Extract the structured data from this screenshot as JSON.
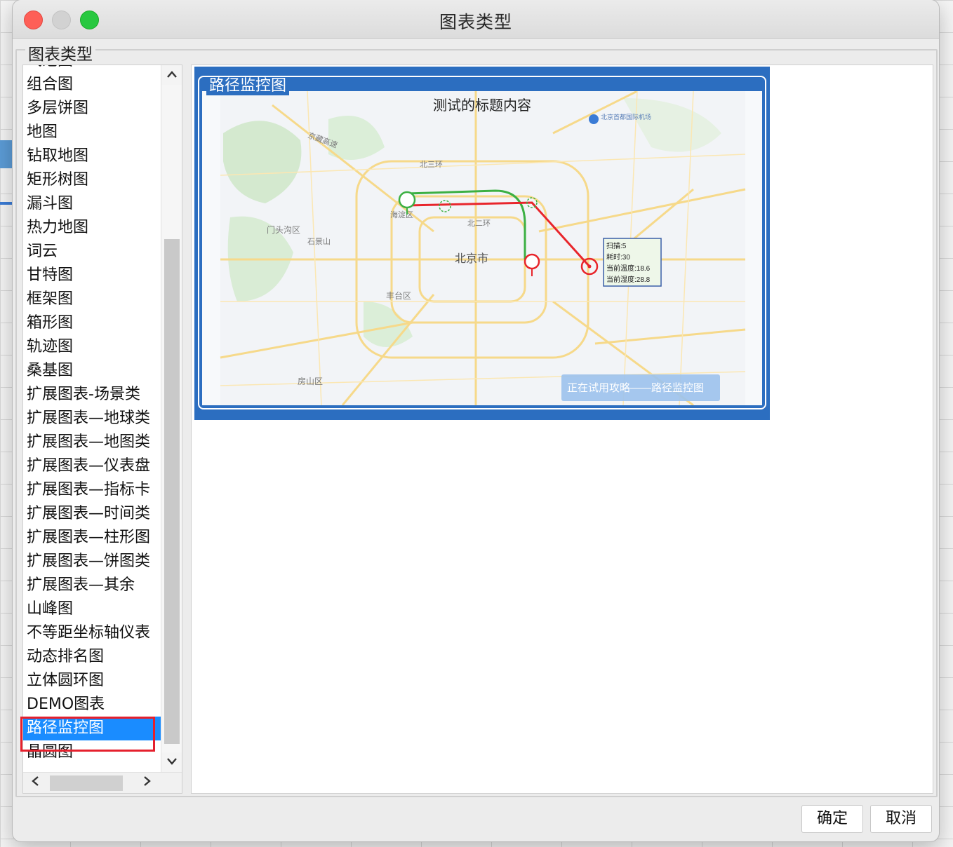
{
  "window": {
    "title": "图表类型"
  },
  "group": {
    "legend": "图表类型"
  },
  "chart_list": {
    "items": [
      "气泡图",
      "组合图",
      "多层饼图",
      "地图",
      "钻取地图",
      "矩形树图",
      "漏斗图",
      "热力地图",
      "词云",
      "甘特图",
      "框架图",
      "箱形图",
      "轨迹图",
      "桑基图",
      "扩展图表-场景类",
      "扩展图表—地球类",
      "扩展图表—地图类",
      "扩展图表—仪表盘",
      "扩展图表—指标卡",
      "扩展图表—时间类",
      "扩展图表—柱形图",
      "扩展图表—饼图类",
      "扩展图表—其余",
      "山峰图",
      "不等距坐标轴仪表",
      "动态排名图",
      "立体圆环图",
      "DEMO图表",
      "路径监控图",
      "晶圆图"
    ],
    "selected_index": 28
  },
  "preview": {
    "card_title": "路径监控图",
    "chart_title": "测试的标题内容",
    "map_labels": {
      "city": "北京市",
      "district1": "海淀区",
      "district2": "门头沟区",
      "district3": "丰台区",
      "district4": "房山区",
      "airport": "北京首都国际机场",
      "road1": "北三环",
      "road2": "北二环",
      "road3": "京藏高速",
      "road4": "石景山"
    },
    "tooltip_lines": [
      "扫描:5",
      "耗时:30",
      "当前温度:18.6",
      "当前湿度:28.8"
    ],
    "watermark": "正在试用攻略——路径监控图",
    "colors": {
      "route_green": "#3cb043",
      "route_red": "#e8252b",
      "card_blue": "#2c6ec0"
    }
  },
  "buttons": {
    "ok": "确定",
    "cancel": "取消"
  },
  "icons": {
    "close": "close-icon",
    "minimize": "minimize-icon",
    "maximize": "maximize-icon",
    "scroll_up": "chevron-up-icon",
    "scroll_down": "chevron-down-icon",
    "scroll_left": "chevron-left-icon",
    "scroll_right": "chevron-right-icon"
  }
}
